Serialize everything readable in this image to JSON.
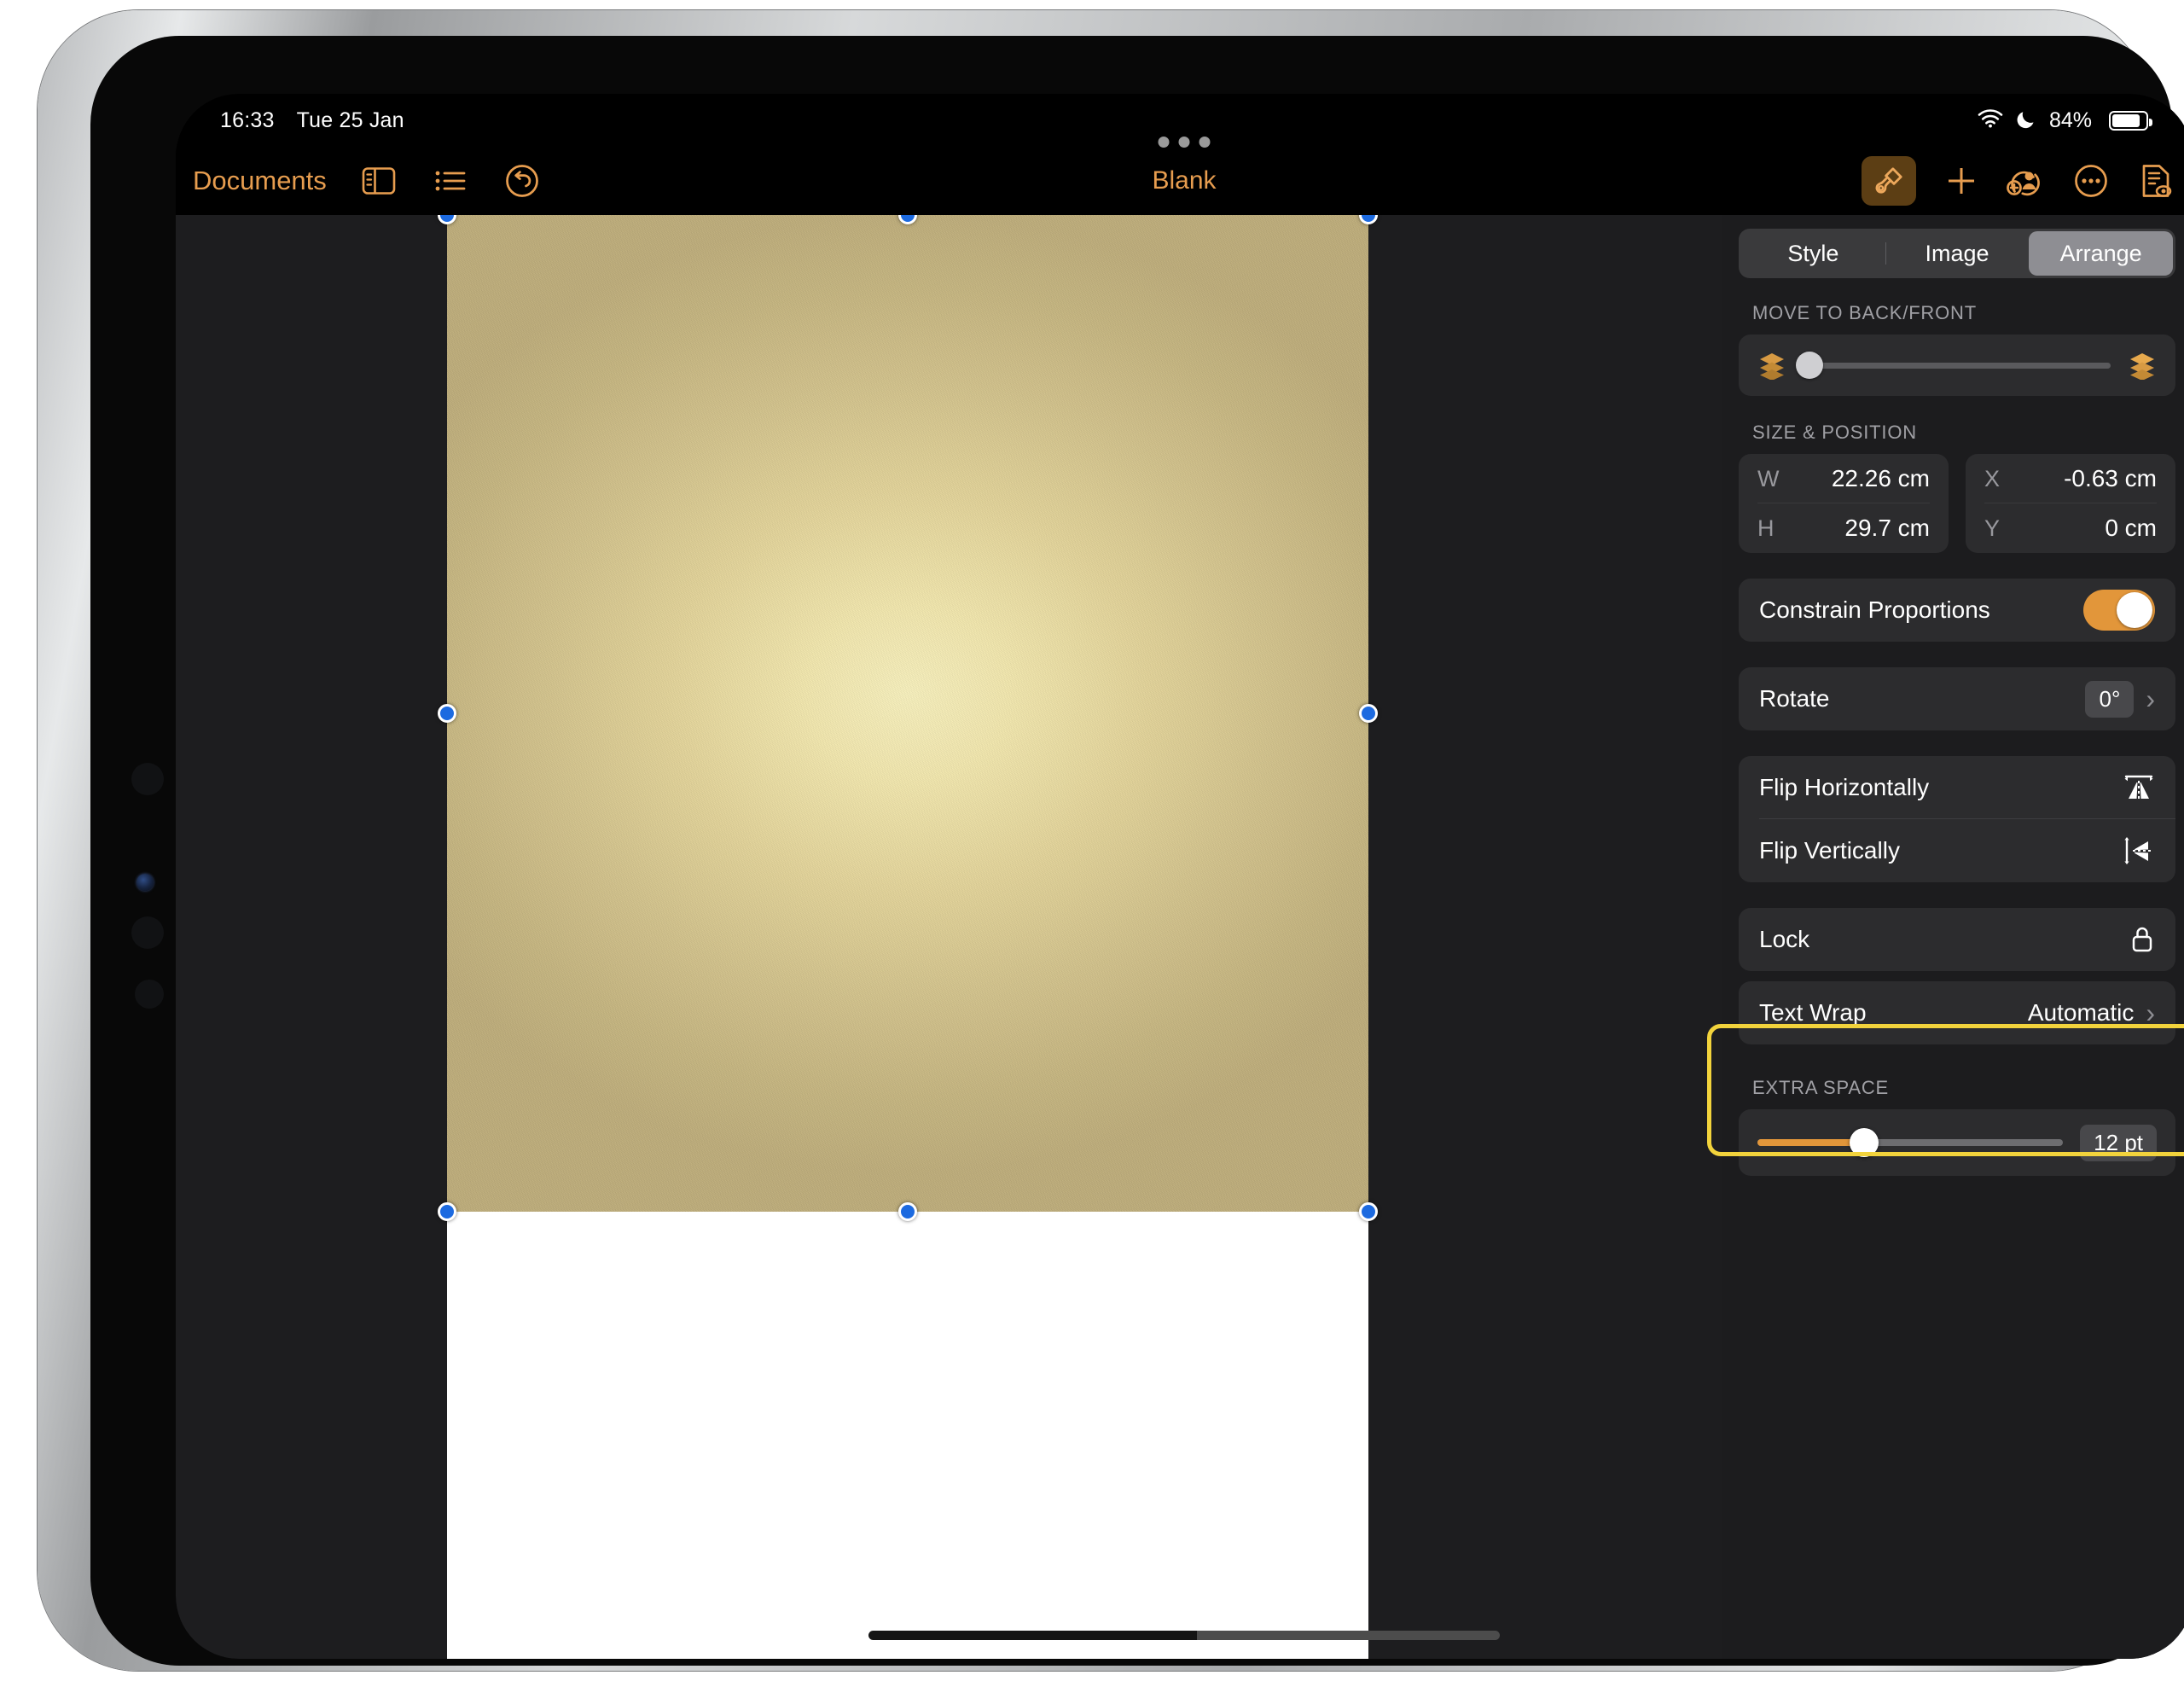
{
  "status_bar": {
    "time": "16:33",
    "date": "Tue 25 Jan",
    "wifi_icon": "wifi-icon",
    "dnd_icon": "moon-icon",
    "battery_percent": "84%",
    "battery_level": 84
  },
  "toolbar": {
    "documents_label": "Documents",
    "sidebar_icon": "sidebar-icon",
    "list_icon": "list-icon",
    "undo_icon": "undo-icon",
    "title": "Blank",
    "brush_icon": "paintbrush-icon",
    "add_icon": "plus-icon",
    "collaborate_icon": "add-person-icon",
    "more_icon": "ellipsis-circle-icon",
    "document_view_icon": "document-preview-icon"
  },
  "inspector": {
    "tabs": [
      {
        "label": "Style",
        "active": false
      },
      {
        "label": "Image",
        "active": false
      },
      {
        "label": "Arrange",
        "active": true
      }
    ],
    "move_section": {
      "label": "MOVE TO BACK/FRONT",
      "back_icon": "send-to-back-icon",
      "front_icon": "bring-to-front-icon",
      "slider_value": 2
    },
    "size_section": {
      "label": "SIZE & POSITION",
      "fields": [
        {
          "key": "W",
          "value": "22.26 cm"
        },
        {
          "key": "H",
          "value": "29.7 cm"
        },
        {
          "key": "X",
          "value": "-0.63 cm"
        },
        {
          "key": "Y",
          "value": "0 cm"
        }
      ]
    },
    "constrain": {
      "label": "Constrain Proportions",
      "enabled": true
    },
    "rotate": {
      "label": "Rotate",
      "value": "0°",
      "chevron_icon": "chevron-right-icon"
    },
    "flip_horizontally": {
      "label": "Flip Horizontally",
      "icon": "flip-horizontal-icon"
    },
    "flip_vertically": {
      "label": "Flip Vertically",
      "icon": "flip-vertical-icon"
    },
    "lock": {
      "label": "Lock",
      "icon": "lock-icon",
      "highlighted": true
    },
    "text_wrap": {
      "label": "Text Wrap",
      "value": "Automatic",
      "chevron_icon": "chevron-right-icon"
    },
    "extra_space": {
      "label": "EXTRA SPACE",
      "value": "12 pt",
      "slider_percent": 35
    }
  },
  "canvas": {
    "page_background": "#ffffff",
    "image_name": "gold-gradient-image",
    "image_colors": {
      "center": "#f7f0bd",
      "edge": "#bfae7c"
    },
    "selection_handles": 8,
    "handle_color": "#1c6ae0"
  },
  "colors": {
    "accent": "#e79d4f",
    "toggle_on": "#e2963a",
    "highlight": "#f2d33c",
    "panel_bg": "#1c1c1e",
    "card_bg": "#2c2c2e",
    "canvas_bg": "#1d1d1f"
  }
}
